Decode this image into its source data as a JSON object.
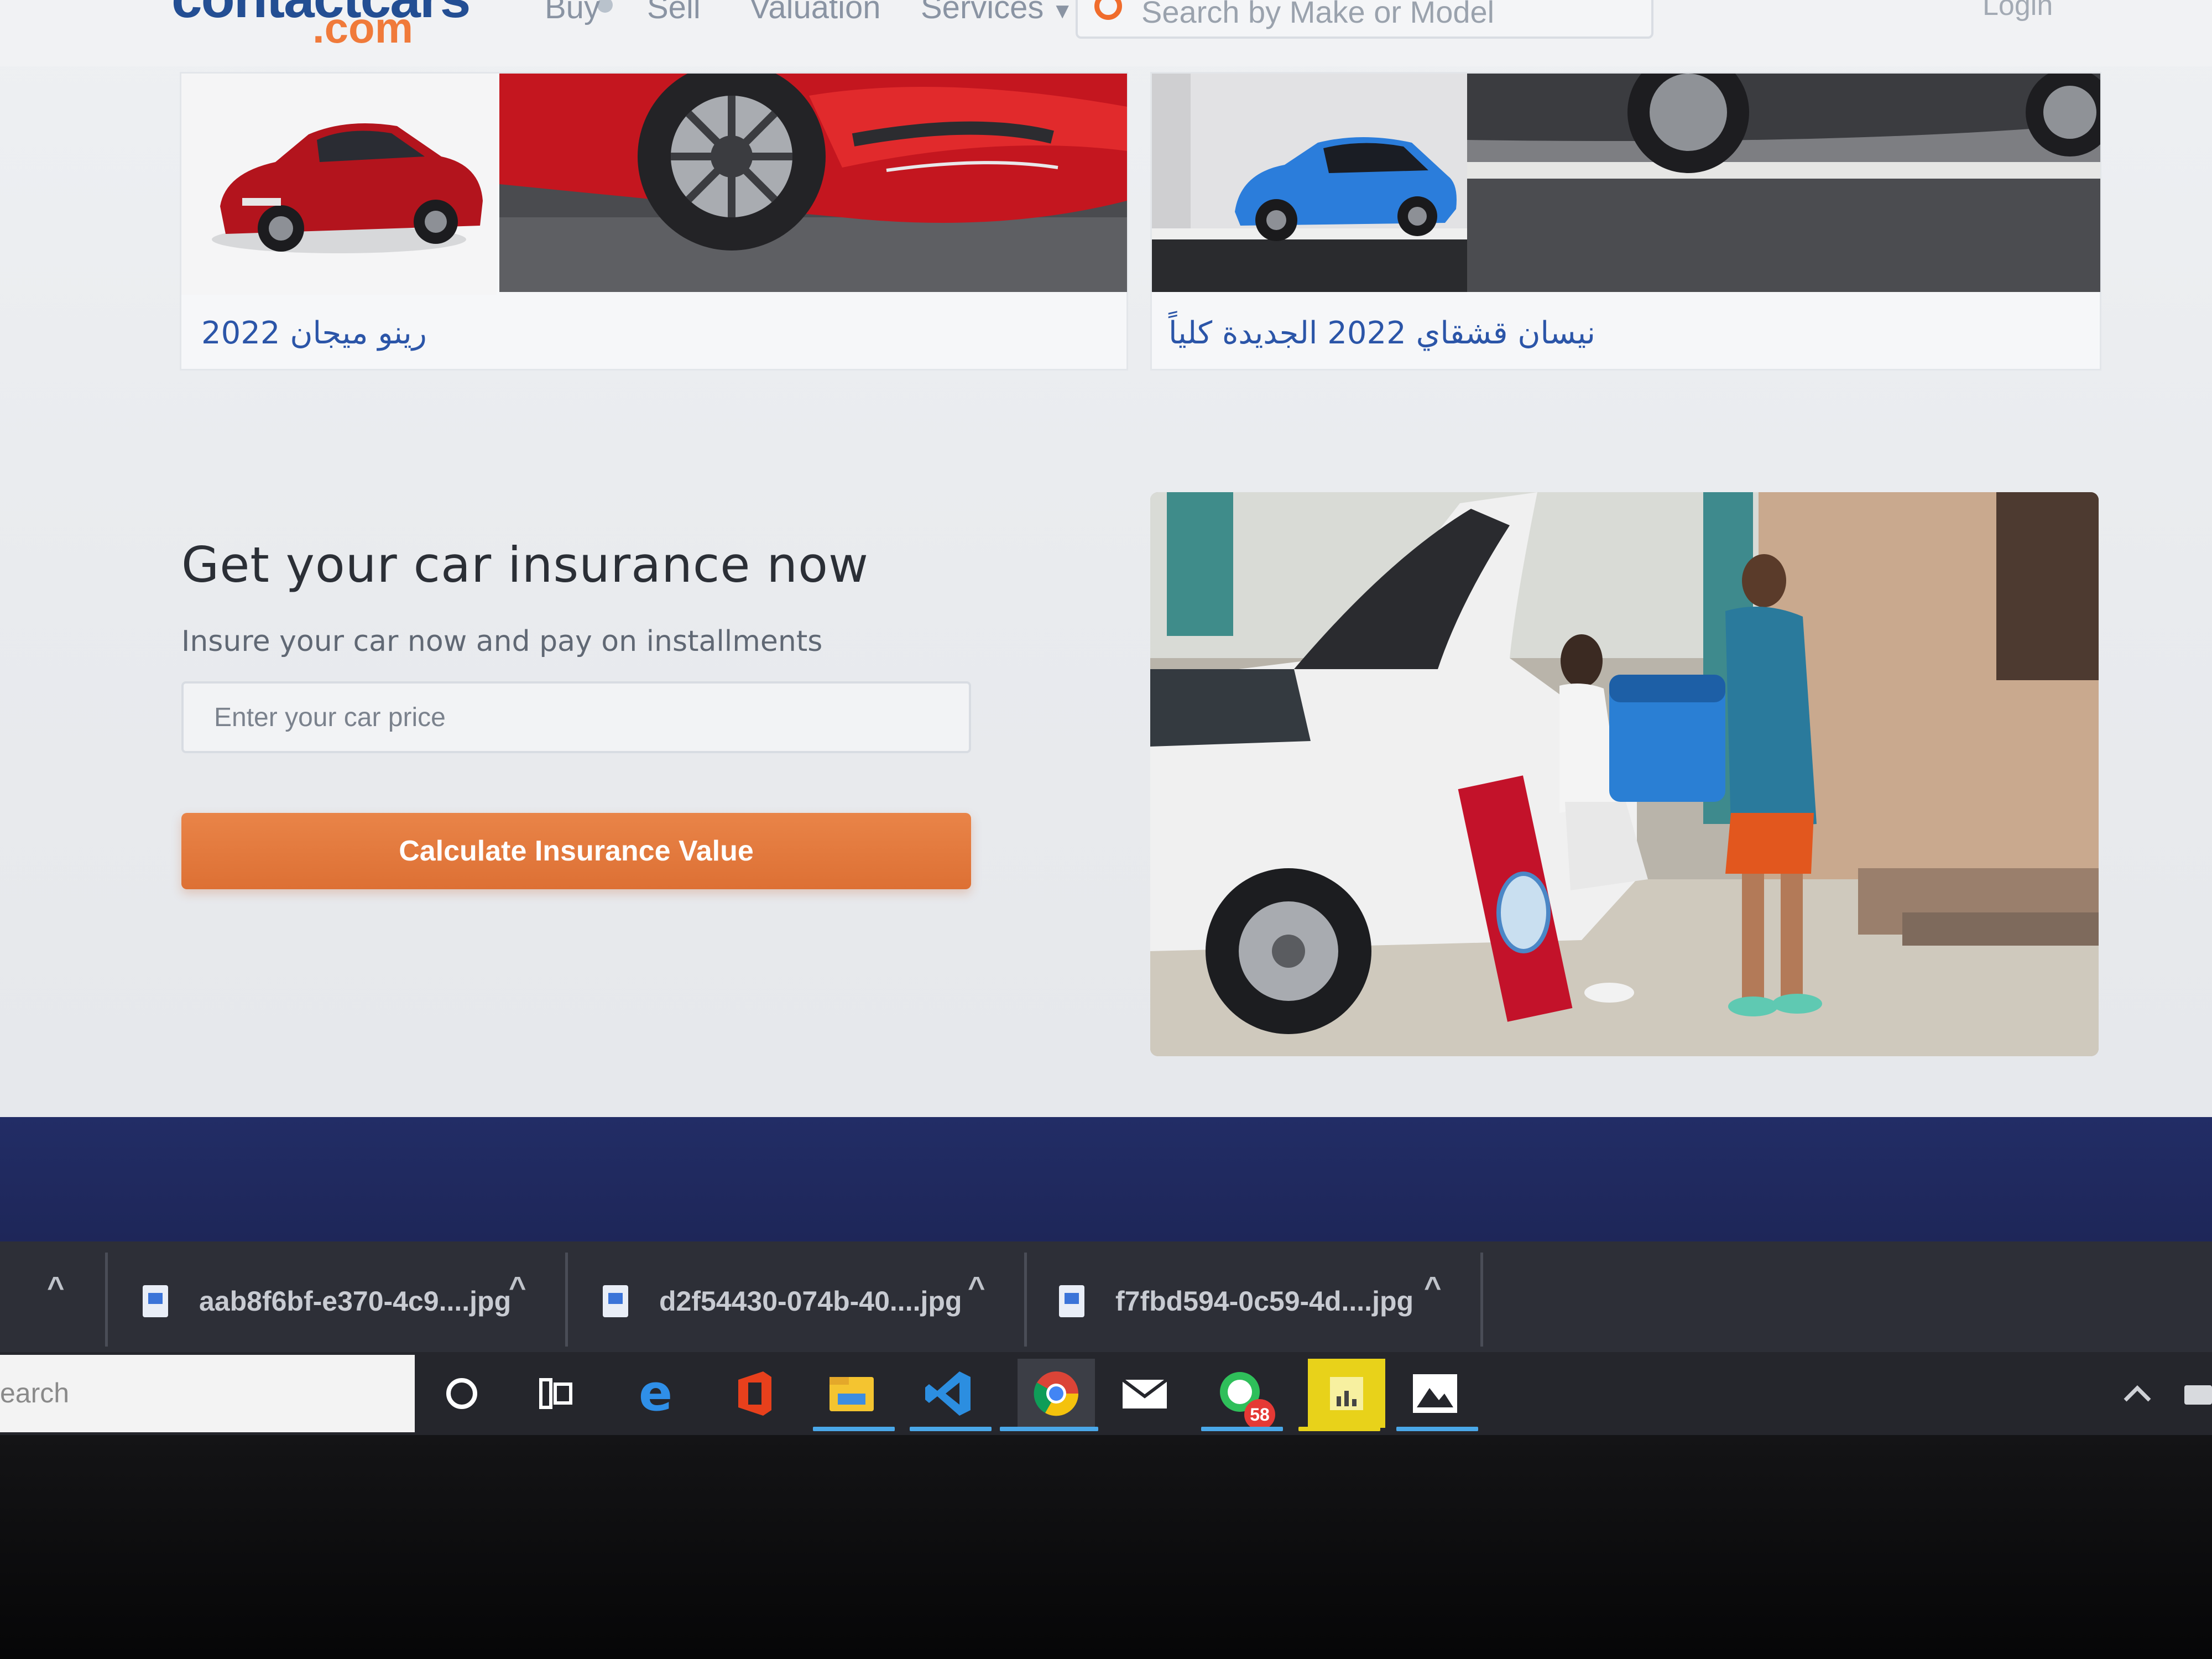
{
  "header": {
    "logo_brand": "contactcars",
    "logo_domain": ".com",
    "nav": [
      "Buy",
      "Sell",
      "Valuation",
      "Services"
    ],
    "search_placeholder": "Search by Make or Model",
    "login": "Login"
  },
  "cards": [
    {
      "title": "رينو ميجان 2022"
    },
    {
      "title": "نيسان قشقاي 2022 الجديدة كلياً"
    }
  ],
  "insurance": {
    "title": "Get your car insurance now",
    "subtitle": "Insure your car now and pay on installments",
    "input_placeholder": "Enter your car price",
    "button_label": "Calculate Insurance Value"
  },
  "downloads": [
    {
      "name": "aab8f6bf-e370-4c9....jpg"
    },
    {
      "name": "d2f54430-074b-40....jpg"
    },
    {
      "name": "f7fbd594-0c59-4d....jpg"
    }
  ],
  "taskbar": {
    "search_text": "earch",
    "whatsapp_badge": "58",
    "icons": [
      "cortana-icon",
      "task-view-icon",
      "edge-icon",
      "office-icon",
      "file-explorer-icon",
      "vscode-icon",
      "chrome-icon",
      "mail-icon",
      "whatsapp-icon",
      "sticky-app-icon",
      "photos-icon"
    ]
  }
}
